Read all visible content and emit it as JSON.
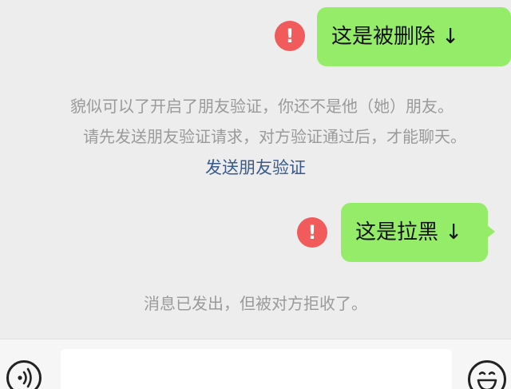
{
  "messages": {
    "deleted_bubble": "这是被删除 ↓",
    "deleted_error_icon": "!",
    "friend_verify_line1": "貌似可以了开启了朋友验证，你还不是他（她）朋友。",
    "friend_verify_line2": "请先发送朋友验证请求，对方验证通过后，才能聊天。",
    "send_verify_link": "发送朋友验证",
    "blocked_bubble": "这是拉黑 ↓",
    "blocked_error_icon": "!",
    "rejected_notice": "消息已发出，但被对方拒收了。"
  },
  "input_bar": {
    "text_value": "",
    "voice_icon": "voice-icon",
    "emoji_icon": "emoji-icon"
  },
  "colors": {
    "chat_background": "#ededed",
    "bubble_green": "#95ec69",
    "error_red": "#f15b5b",
    "link_blue": "#3a5a8c",
    "system_gray": "#9a9a9a"
  }
}
